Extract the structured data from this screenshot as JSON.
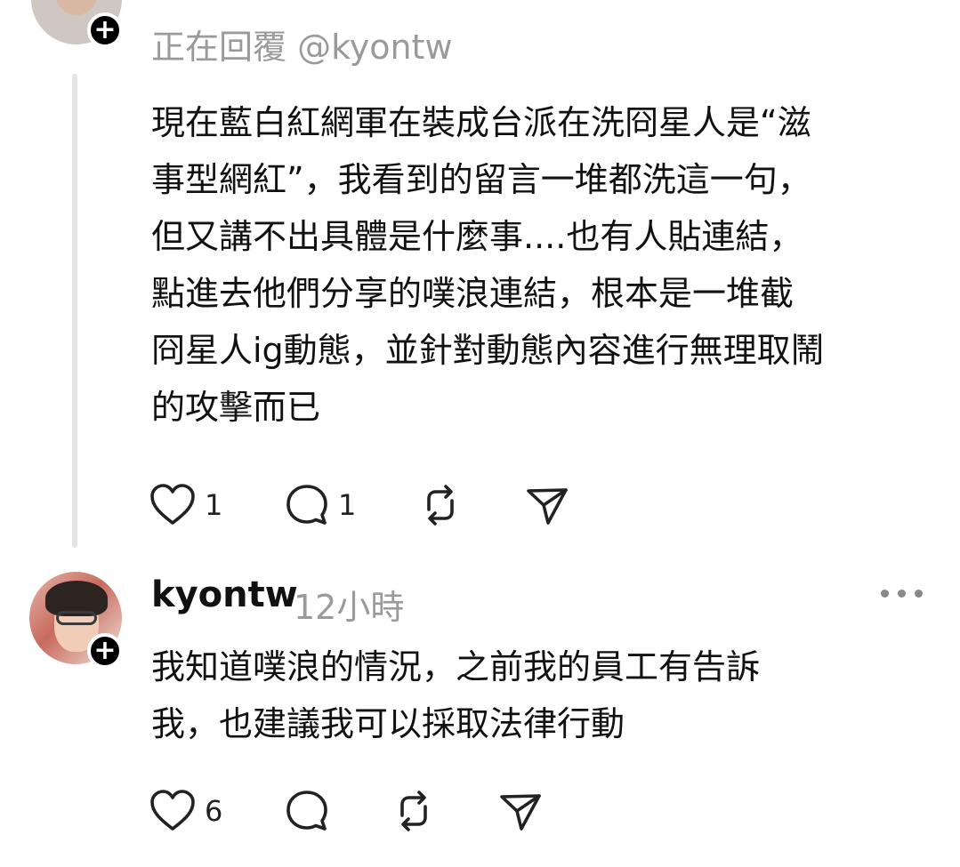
{
  "reply_context": {
    "replying_to": "正在回覆 @kyontw",
    "body_lines": [
      "現在藍白紅網軍在裝成台派在洗冏星人是“滋",
      "事型網紅”，我看到的留言一堆都洗這一句，",
      "但又講不出具體是什麼事....也有人貼連結，",
      "點進去他們分享的噗浪連結，根本是一堆截",
      "冏星人ig動態，並針對動態內容進行無理取鬧",
      "的攻擊而已"
    ],
    "likes": "1",
    "replies": "1"
  },
  "reply": {
    "username": "kyontw",
    "time": "12小時",
    "body_lines": [
      "我知道噗浪的情況，之前我的員工有告訴",
      "我，也建議我可以採取法律行動"
    ],
    "likes": "6"
  },
  "follow_badge": "+",
  "icons": {
    "like": "heart-icon",
    "reply": "speech-bubble-icon",
    "repost": "repost-icon",
    "share": "send-icon",
    "more": "more-dots-icon"
  },
  "colors": {
    "text": "#111111",
    "muted": "#9a9a9a",
    "thread_line": "#e4e4e4",
    "badge": "#000000"
  }
}
